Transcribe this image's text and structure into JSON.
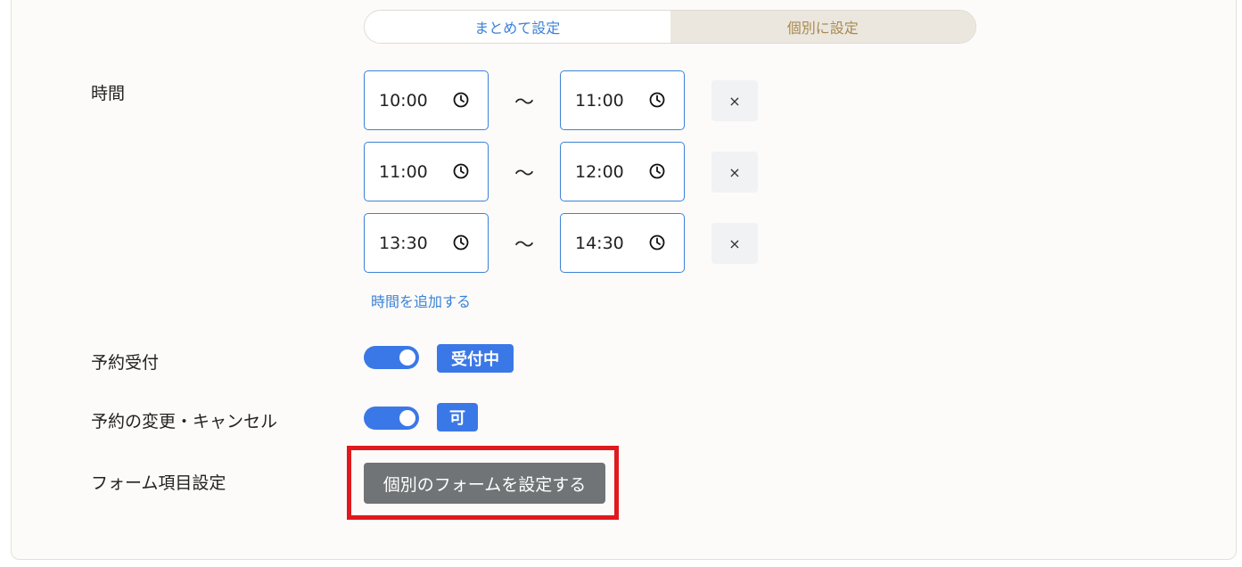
{
  "segmented": {
    "left_label": "まとめて設定",
    "right_label": "個別に設定"
  },
  "time_section": {
    "label": "時間",
    "separator": "〜",
    "delete_label": "×",
    "slots": [
      {
        "start": "10:00",
        "end": "11:00"
      },
      {
        "start": "11:00",
        "end": "12:00"
      },
      {
        "start": "13:30",
        "end": "14:30"
      }
    ],
    "add_label": "時間を追加する"
  },
  "reservation": {
    "label": "予約受付",
    "toggle_on": true,
    "badge": "受付中"
  },
  "change_cancel": {
    "label": "予約の変更・キャンセル",
    "toggle_on": true,
    "badge": "可"
  },
  "form_settings": {
    "label": "フォーム項目設定",
    "button_label": "個別のフォームを設定する"
  },
  "colors": {
    "accent": "#3b78e7",
    "link": "#3b82d6",
    "highlight": "#e0191e",
    "gold": "#a9894f"
  }
}
